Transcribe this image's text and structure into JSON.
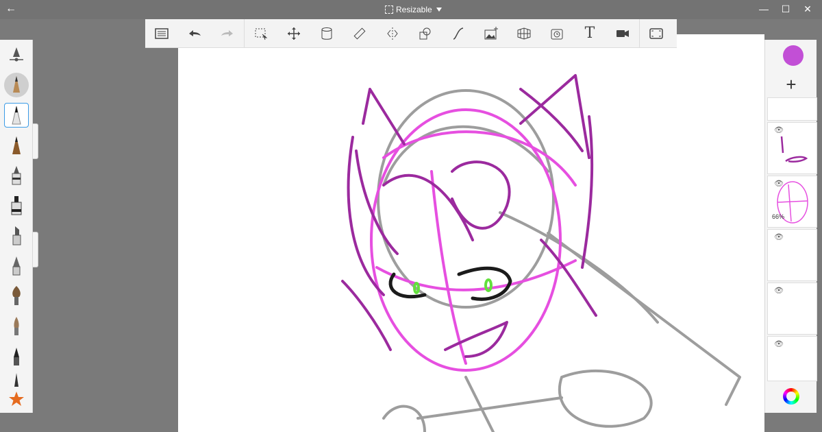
{
  "titlebar": {
    "back_icon": "arrow-left-icon",
    "canvas_mode_label": "Resizable"
  },
  "window_controls": {
    "minimize_symbol": "—",
    "maximize_symbol": "☐",
    "close_symbol": "✕"
  },
  "toolbar": {
    "text_tool_label": "T",
    "items": [
      "list-icon",
      "undo-icon",
      "redo-icon",
      "selection-icon",
      "transform-icon",
      "fill-icon",
      "ruler-icon",
      "symmetry-icon",
      "shapes-icon",
      "curve-icon",
      "add-image-icon",
      "perspective-icon",
      "time-lapse-icon",
      "text-icon",
      "video-icon",
      "fullscreen-icon"
    ]
  },
  "brush_palette": {
    "selected_index": 2,
    "items": [
      "brush-properties-icon",
      "pencil-icon",
      "pencil-selected-icon",
      "hard-pencil-icon",
      "ballpoint-pen-icon",
      "marker-icon",
      "chisel-marker-icon",
      "airbrush-icon",
      "paintbrush-icon",
      "soft-brush-icon",
      "ink-pen-icon",
      "fine-pen-icon",
      "favorite-star-icon"
    ]
  },
  "layers": {
    "current_color": "#c24fd6",
    "add_symbol": "+",
    "items": [
      {
        "visible": true,
        "opacity_label": ""
      },
      {
        "visible": true,
        "opacity_label": "66%"
      },
      {
        "visible": true,
        "opacity_label": ""
      },
      {
        "visible": true,
        "opacity_label": ""
      },
      {
        "visible": true,
        "opacity_label": ""
      }
    ]
  },
  "colors": {
    "sketch_magenta": "#e64fe0",
    "sketch_purple": "#9b2a9e",
    "sketch_gray": "#8d8d8d",
    "ink_black": "#1b1b1b",
    "eye_green": "#63e03d",
    "selection_blue": "#3b9be6"
  }
}
